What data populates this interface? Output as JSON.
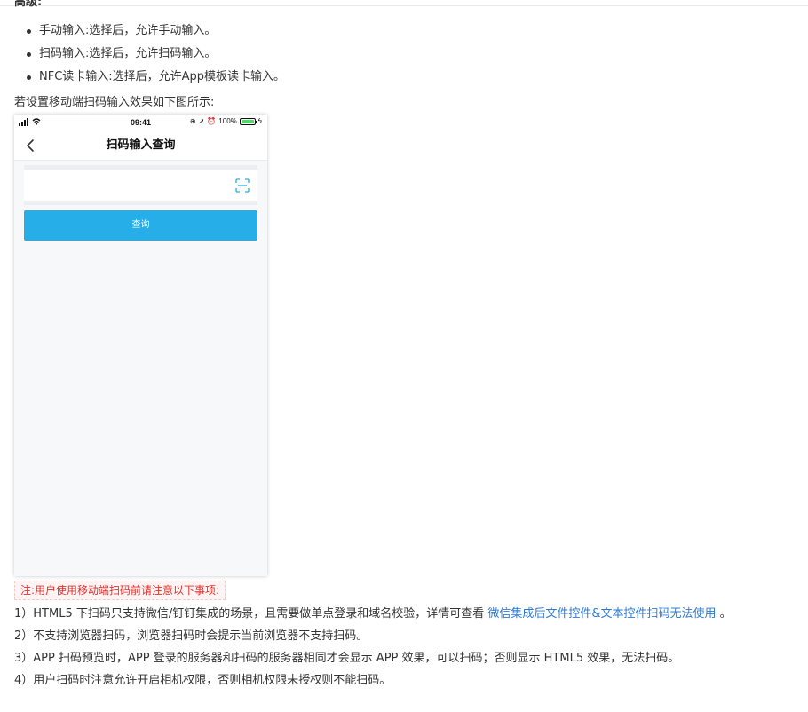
{
  "section": {
    "heading": "高级:"
  },
  "bullets": [
    "手动输入:选择后，允许手动输入。",
    "扫码输入:选择后，允许扫码输入。",
    "NFC读卡输入:选择后，允许App模板读卡输入。"
  ],
  "intro": "若设置移动端扫码输入效果如下图所示:",
  "phone": {
    "status_time": "09:41",
    "battery_text": "100%",
    "battery_level": 1.0,
    "nav_title": "扫码输入查询",
    "query_button": "查询",
    "input_value": "",
    "accent_color": "#26aee8"
  },
  "note": "注:用户使用移动端扫码前请注意以下事项:",
  "items": {
    "item1_before": "1）HTML5 下扫码只支持微信/钉钉集成的场景，且需要做单点登录和域名校验，详情可查看 ",
    "item1_link": "微信集成后文件控件&文本控件扫码无法使用",
    "item1_after": " 。",
    "item2": "2）不支持浏览器扫码，浏览器扫码时会提示当前浏览器不支持扫码。",
    "item3": "3）APP 扫码预览时，APP 登录的服务器和扫码的服务器相同才会显示 APP 效果，可以扫码；否则显示 HTML5 效果，无法扫码。",
    "item4": "4）用户扫码时注意允许开启相机权限，否则相机权限未授权则不能扫码。"
  }
}
